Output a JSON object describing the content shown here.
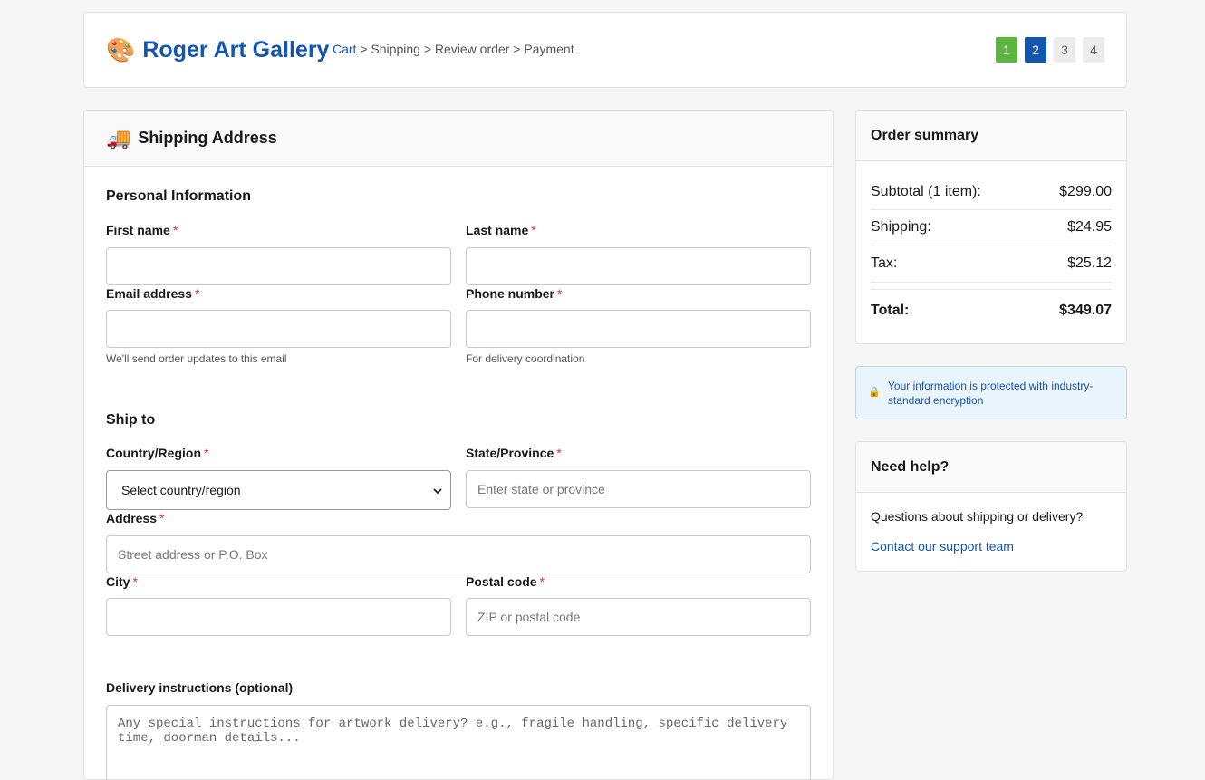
{
  "header": {
    "brand_icon": "🎨",
    "brand_title": "Roger Art Gallery",
    "breadcrumb": {
      "cart": "Cart",
      "sep": ">",
      "shipping": "Shipping",
      "review": "Review order",
      "payment": "Payment"
    },
    "steps": [
      "1",
      "2",
      "3",
      "4"
    ]
  },
  "main": {
    "icon": "🚚",
    "title": "Shipping Address",
    "personal_title": "Personal Information",
    "ship_title": "Ship to",
    "required_mark": "*",
    "first_name_label": "First name",
    "last_name_label": "Last name",
    "email_label": "Email address",
    "email_hint": "We'll send order updates to this email",
    "phone_label": "Phone number",
    "phone_hint": "For delivery coordination",
    "country_label": "Country/Region",
    "country_value": "Select country/region",
    "state_label": "State/Province",
    "state_placeholder": "Enter state or province",
    "address_label": "Address",
    "address_placeholder": "Street address or P.O. Box",
    "city_label": "City",
    "postal_label": "Postal code",
    "postal_placeholder": "ZIP or postal code",
    "delivery_label": "Delivery instructions (optional)",
    "delivery_placeholder": "Any special instructions for artwork delivery? e.g., fragile handling, specific delivery time, doorman details..."
  },
  "summary": {
    "title": "Order summary",
    "subtotal_label": "Subtotal (1 item):",
    "subtotal_value": "$299.00",
    "shipping_label": "Shipping:",
    "shipping_value": "$24.95",
    "tax_label": "Tax:",
    "tax_value": "$25.12",
    "total_label": "Total:",
    "total_value": "$349.07"
  },
  "secure": {
    "icon": "🔒",
    "text": "Your information is protected with industry-standard encryption"
  },
  "help": {
    "title": "Need help?",
    "question": "Questions about shipping or delivery?",
    "link": "Contact our support team"
  },
  "colors": {
    "brand": "#1356b0",
    "step_done": "#5ab640",
    "step_active": "#1356b0",
    "required": "#dd3333"
  }
}
